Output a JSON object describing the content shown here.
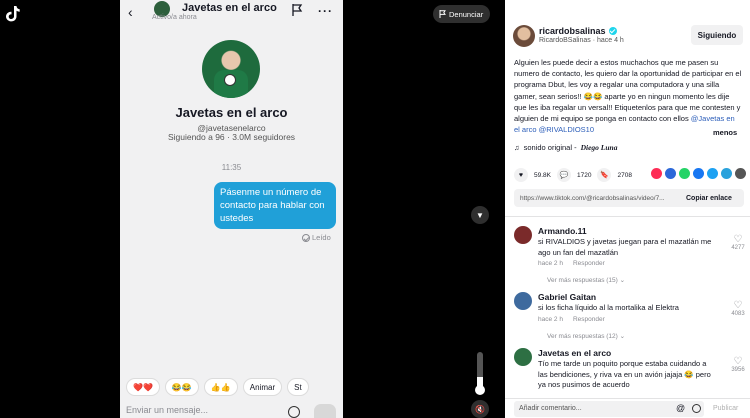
{
  "left": {
    "report_label": "Denunciar"
  },
  "chat": {
    "title": "Javetas en el arco",
    "status": "Activo/a ahora",
    "profile": {
      "name": "Javetas en el arco",
      "handle": "@javetasenelarco",
      "stats": "Siguiendo a 96 · 3.0M seguidores"
    },
    "time": "11:35",
    "message": "Pásenme un número de contacto para hablar con ustedes",
    "read": "Leído",
    "quick_replies": [
      "❤️❤️",
      "😂😂",
      "👍👍",
      "Animar",
      "St"
    ],
    "input_placeholder": "Enviar un mensaje..."
  },
  "post": {
    "author": "ricardobsalinas",
    "author_meta": "RicardoBSalinas · hace 4 h",
    "follow_label": "Siguiendo",
    "caption_text": "Alguien les puede decir a estos muchachos que me pasen su numero de contacto, les quiero dar la oportunidad de participar en el programa Dbut, les voy a regalar una computadora y una silla gamer, sean serios!! 😂😂 aparte yo en ningun momento les dije que les iba regalar un versal!! Etiquetenlos para que me contesten y alguien de mi equipo se ponga en contacto con ellos ",
    "caption_mentions": "@Javetas en el arco @RIVALDIOS10",
    "more_label": "menos",
    "sound_label": "sonido original - ",
    "sound_artist": "Diego Luna",
    "likes": "59.8K",
    "comments": "1720",
    "saves": "2708",
    "share_colors": [
      "#fe2c55",
      "#2b68d9",
      "#25d366",
      "#1877f2",
      "#1da1f2",
      "#2aa2dc",
      "#555555"
    ],
    "link": "https://www.tiktok.com/@ricardobsalinas/video/7...",
    "copy_label": "Copiar enlace"
  },
  "comments": [
    {
      "user": "Armando.11",
      "text": "si RIVALDIOS y javetas juegan para el mazatlán me ago un fan del mazatlán",
      "time": "hace 2 h",
      "reply": "Responder",
      "likes": "4277",
      "replies": "Ver más respuestas (15)"
    },
    {
      "user": "Gabriel Gaitan",
      "text": "si los ficha líquido al la mortalika al Elektra",
      "time": "hace 2 h",
      "reply": "Responder",
      "likes": "4083",
      "replies": "Ver más respuestas (12)"
    },
    {
      "user": "Javetas en el arco",
      "text": "Tío me tarde un poquito porque estaba cuidando a las bendiciones, y riva va en un avión jajaja 😂 pero ya nos pusimos de acuerdo",
      "likes": "3956"
    }
  ],
  "footer": {
    "comment_placeholder": "Añadir comentario...",
    "publish_label": "Publicar"
  },
  "volume_level": 0.35
}
